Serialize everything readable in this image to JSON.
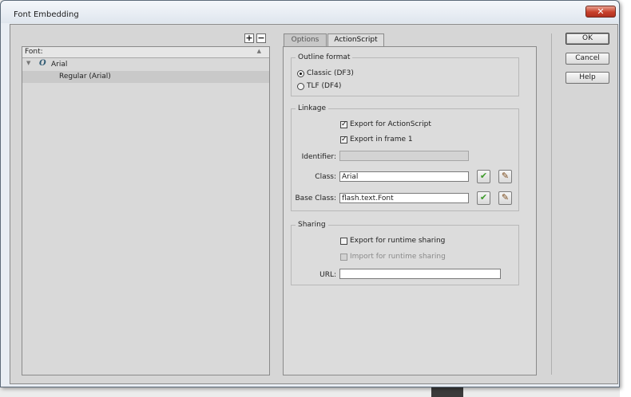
{
  "window": {
    "title": "Font Embedding",
    "close_glyph": "✕"
  },
  "font_list": {
    "add_label": "+",
    "remove_label": "−",
    "header": "Font:",
    "families": [
      {
        "name": "Arial",
        "icon": "opentype-font-icon",
        "styles": [
          "Regular (Arial)"
        ]
      }
    ]
  },
  "tabs": [
    {
      "label": "Options",
      "active": false
    },
    {
      "label": "ActionScript",
      "active": true
    }
  ],
  "outline_format": {
    "title": "Outline format",
    "options": [
      {
        "label": "Classic (DF3)",
        "selected": true
      },
      {
        "label": "TLF (DF4)",
        "selected": false
      }
    ]
  },
  "linkage": {
    "title": "Linkage",
    "export_for_actionscript": {
      "label": "Export for ActionScript",
      "checked": true
    },
    "export_in_frame_1": {
      "label": "Export in frame 1",
      "checked": true
    },
    "identifier": {
      "label": "Identifier:",
      "value": ""
    },
    "class": {
      "label": "Class:",
      "value": "Arial"
    },
    "base_class": {
      "label": "Base Class:",
      "value": "flash.text.Font"
    }
  },
  "sharing": {
    "title": "Sharing",
    "export_for_runtime": {
      "label": "Export for runtime sharing",
      "checked": false
    },
    "import_for_runtime": {
      "label": "Import for runtime sharing",
      "checked": false
    },
    "url": {
      "label": "URL:",
      "value": ""
    }
  },
  "buttons": {
    "ok": "OK",
    "cancel": "Cancel",
    "help": "Help"
  },
  "glyphs": {
    "check": "✓",
    "validate": "✔",
    "edit": "✎",
    "expand": "▼",
    "sort": "▲"
  }
}
